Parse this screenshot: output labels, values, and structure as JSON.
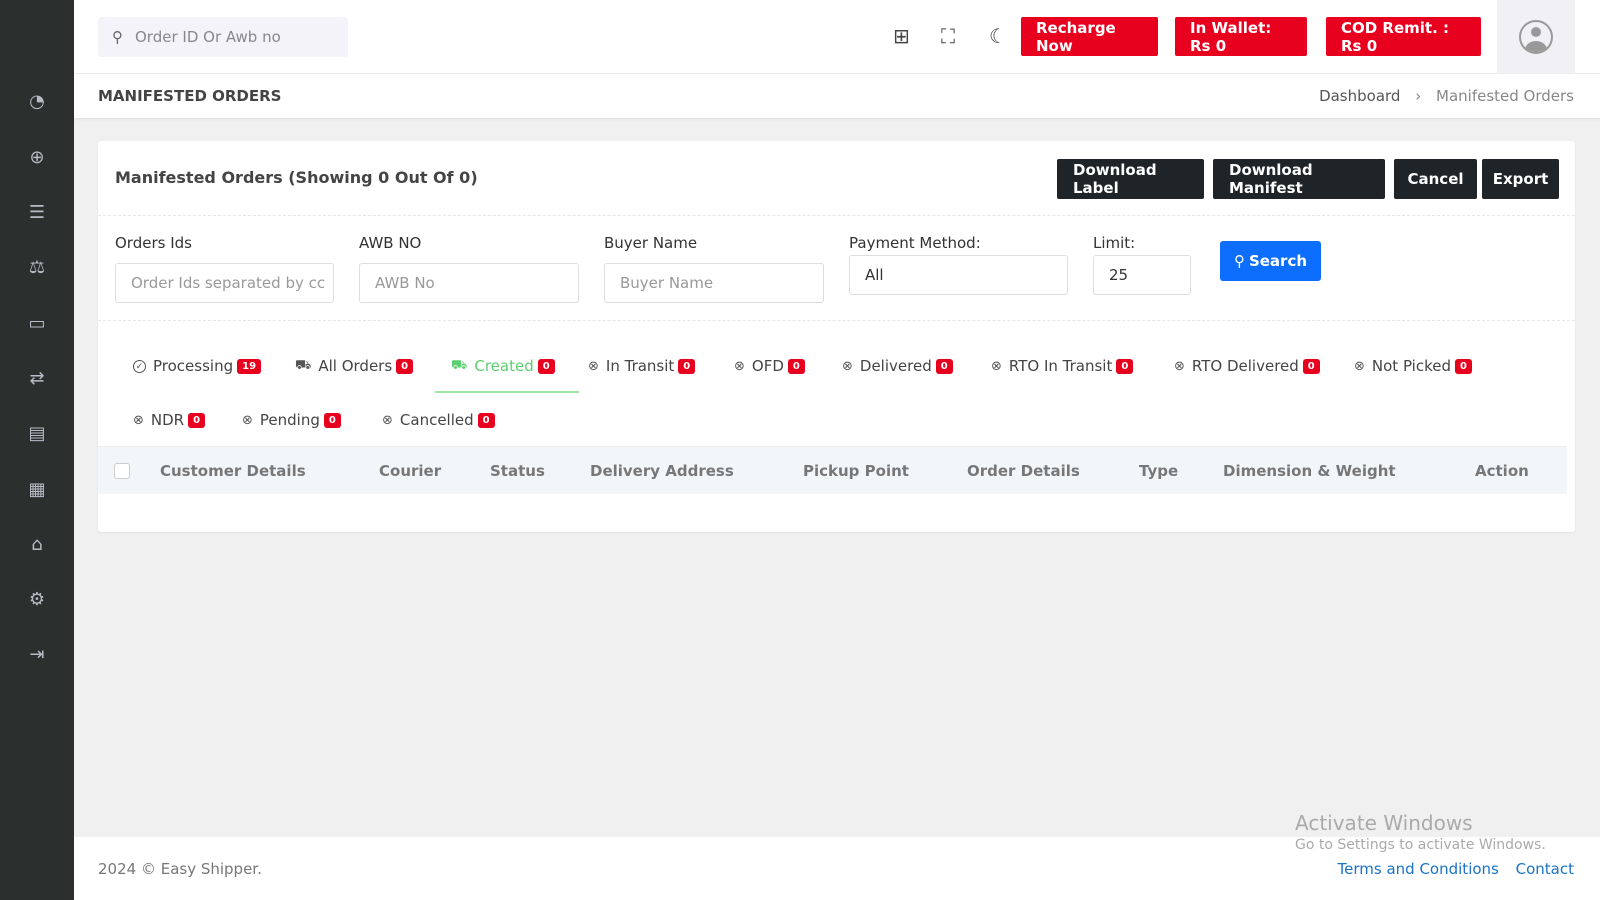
{
  "sidebar": {
    "items": [
      "dashboard-icon",
      "add-order-icon",
      "orders-list-icon",
      "weight-dispute-icon",
      "wallet-icon",
      "transfer-icon",
      "reports-icon",
      "calculator-icon",
      "store-icon",
      "settings-icon",
      "logout-icon"
    ]
  },
  "header": {
    "search_placeholder": "Order ID Or Awb no",
    "recharge": "Recharge Now",
    "wallet": "In Wallet: Rs 0",
    "cod": "COD Remit. : Rs 0"
  },
  "page": {
    "title": "MANIFESTED ORDERS",
    "breadcrumb": [
      "Dashboard",
      "Manifested Orders"
    ]
  },
  "card": {
    "title": "Manifested Orders (Showing 0 Out Of 0)",
    "buttons": {
      "download_label": "Download Label",
      "download_manifest": "Download Manifest",
      "cancel": "Cancel",
      "export": "Export"
    }
  },
  "filters": {
    "order_ids": {
      "label": "Orders Ids",
      "placeholder": "Order Ids separated by cc"
    },
    "awb": {
      "label": "AWB NO",
      "placeholder": "AWB No"
    },
    "buyer": {
      "label": "Buyer Name",
      "placeholder": "Buyer Name"
    },
    "payment": {
      "label": "Payment Method:",
      "value": "All"
    },
    "limit": {
      "label": "Limit:",
      "value": "25"
    },
    "search": "Search"
  },
  "tabs": [
    {
      "label": "Processing",
      "count": "19",
      "icon": "check-circle"
    },
    {
      "label": "All Orders",
      "count": "0",
      "icon": "truck"
    },
    {
      "label": "Created",
      "count": "0",
      "icon": "truck",
      "active": true
    },
    {
      "label": "In Transit",
      "count": "0",
      "icon": "x-circle"
    },
    {
      "label": "OFD",
      "count": "0",
      "icon": "x-circle"
    },
    {
      "label": "Delivered",
      "count": "0",
      "icon": "x-circle"
    },
    {
      "label": "RTO In Transit",
      "count": "0",
      "icon": "x-circle"
    },
    {
      "label": "RTO Delivered",
      "count": "0",
      "icon": "x-circle"
    },
    {
      "label": "Not Picked",
      "count": "0",
      "icon": "x-circle"
    },
    {
      "label": "NDR",
      "count": "0",
      "icon": "x-circle"
    },
    {
      "label": "Pending",
      "count": "0",
      "icon": "x-circle"
    },
    {
      "label": "Cancelled",
      "count": "0",
      "icon": "x-circle"
    }
  ],
  "table": {
    "columns": [
      "Customer Details",
      "Courier",
      "Status",
      "Delivery Address",
      "Pickup Point",
      "Order Details",
      "Type",
      "Dimension & Weight",
      "Action"
    ]
  },
  "footer": {
    "copyright": "2024 © Easy Shipper.",
    "links": [
      "Terms and Conditions",
      "Contact"
    ]
  },
  "watermark": {
    "line1": "Activate Windows",
    "line2": "Go to Settings to activate Windows."
  },
  "colors": {
    "accent_red": "#e8001f",
    "primary_blue": "#0d6efd",
    "active_green": "#5ccf70",
    "sidebar": "#2b2f2e"
  }
}
